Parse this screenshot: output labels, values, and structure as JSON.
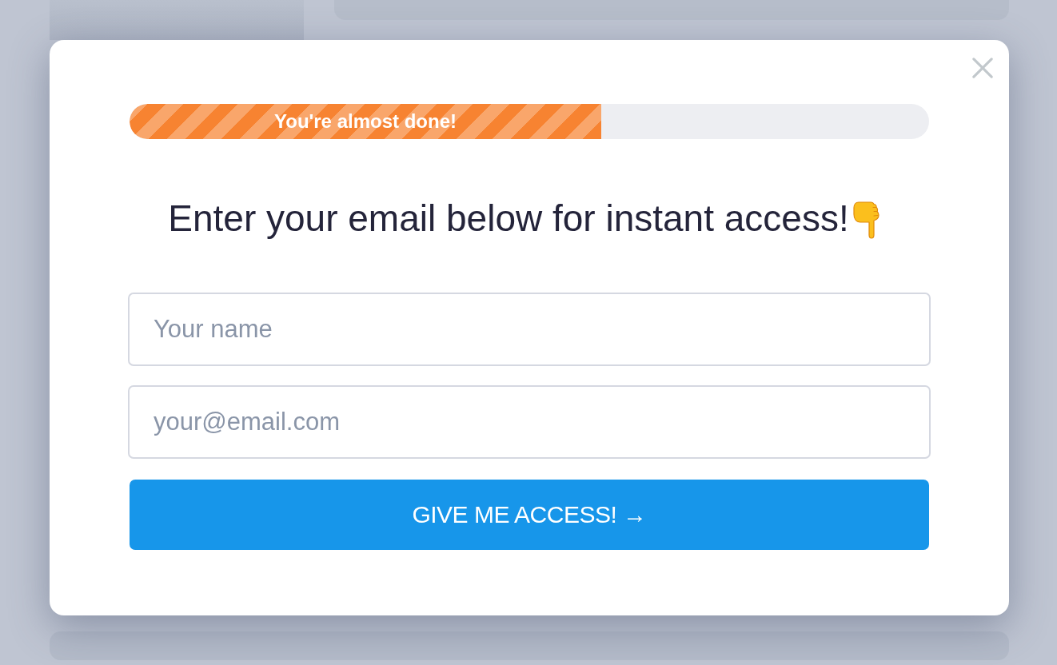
{
  "progress": {
    "label": "You're almost done!",
    "level": 0.59
  },
  "heading": "Enter your email below for instant access!",
  "fields": [
    {
      "placeholder": "Your name"
    },
    {
      "placeholder": "your@email.com"
    }
  ],
  "submit_button": "GIVE ME ACCESS! →"
}
